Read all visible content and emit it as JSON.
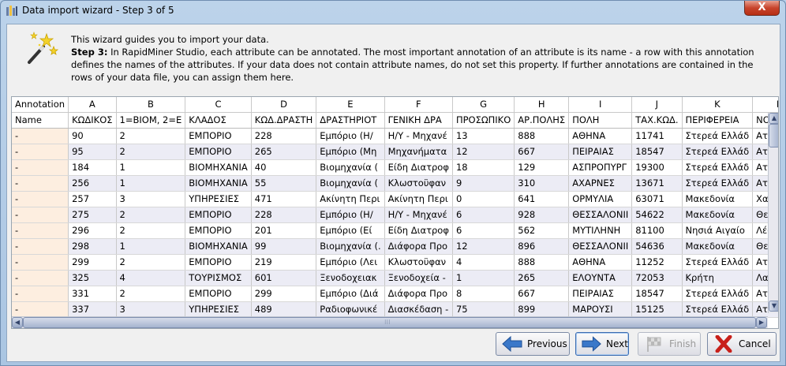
{
  "window": {
    "title": "Data import wizard - Step 3 of 5",
    "close_label": "X"
  },
  "intro": {
    "line1": "This wizard guides you to import your data.",
    "step_label": "Step 3:",
    "step_text": " In RapidMiner Studio, each attribute can be annotated. The most important annotation of an attribute is its name - a row with this annotation defines the names of the attributes. If your data does not contain attribute names, do not set this property. If further annotations are contained in the rows of your data file, you can assign them here."
  },
  "grid": {
    "annotation_header": "Annotation",
    "column_letters": [
      "A",
      "B",
      "C",
      "D",
      "E",
      "F",
      "G",
      "H",
      "I",
      "J",
      "K",
      "L"
    ],
    "header_row": {
      "annotation": "Name",
      "cells": [
        "ΚΩΔΙΚΟΣ",
        "1=ΒΙΟΜ, 2=Ε",
        "ΚΛΑΔΟΣ",
        "ΚΩΔ.ΔΡΑΣΤΗ",
        "ΔΡΑΣΤΗΡΙΟΤ",
        "ΓΕΝΙΚΗ ΔΡΑ",
        "ΠΡΟΣΩΠΙΚΟ",
        "ΑΡ.ΠΟΛΗΣ",
        "ΠΟΛΗ",
        "ΤΑΧ.ΚΩΔ.",
        "ΠΕΡΙΦΕΡΕΙΑ",
        "ΝΟΜΟΣ"
      ]
    },
    "rows": [
      {
        "annotation": "-",
        "cells": [
          "90",
          "2",
          "ΕΜΠΟΡΙΟ",
          "228",
          "Εμπόριο (Η/",
          "Η/Υ - Μηχανέ",
          "13",
          "888",
          "ΑΘΗΝΑ",
          "11741",
          "Στερεά Ελλάδ",
          "Αττική"
        ]
      },
      {
        "annotation": "-",
        "cells": [
          "95",
          "2",
          "ΕΜΠΟΡΙΟ",
          "265",
          "Εμπόριο (Μη",
          "Μηχανήματα",
          "12",
          "667",
          "ΠΕΙΡΑΙΑΣ",
          "18547",
          "Στερεά Ελλάδ",
          "Αττική"
        ]
      },
      {
        "annotation": "-",
        "cells": [
          "184",
          "1",
          "ΒΙΟΜΗΧΑΝΙΑ",
          "40",
          "Βιομηχανία (",
          "Είδη Διατροφ",
          "18",
          "129",
          "ΑΣΠΡΟΠΥΡΓ",
          "19300",
          "Στερεά Ελλάδ",
          "Αττική"
        ]
      },
      {
        "annotation": "-",
        "cells": [
          "256",
          "1",
          "ΒΙΟΜΗΧΑΝΙΑ",
          "55",
          "Βιομηχανία (",
          "Κλωστοϋφαν",
          "9",
          "310",
          "ΑΧΑΡΝΕΣ",
          "13671",
          "Στερεά Ελλάδ",
          "Αττική"
        ]
      },
      {
        "annotation": "-",
        "cells": [
          "257",
          "3",
          "ΥΠΗΡΕΣΙΕΣ",
          "471",
          "Ακίνητη Περι",
          "Ακίνητη Περι",
          "0",
          "641",
          "ΟΡΜΥΛΙΑ",
          "63071",
          "Μακεδονία",
          "Χαλκιδική"
        ]
      },
      {
        "annotation": "-",
        "cells": [
          "275",
          "2",
          "ΕΜΠΟΡΙΟ",
          "228",
          "Εμπόριο (Η/",
          "Η/Υ - Μηχανέ",
          "6",
          "928",
          "ΘΕΣΣΑΛΟΝΙΙ",
          "54622",
          "Μακεδονία",
          "Θεσσαλον"
        ]
      },
      {
        "annotation": "-",
        "cells": [
          "296",
          "2",
          "ΕΜΠΟΡΙΟ",
          "201",
          "Εμπόριο (Εί",
          "Είδη Διατροφ",
          "6",
          "562",
          "ΜΥΤΙΛΗΝΗ",
          "81100",
          "Νησιά Αιγαίο",
          "Λέσβος"
        ]
      },
      {
        "annotation": "-",
        "cells": [
          "298",
          "1",
          "ΒΙΟΜΗΧΑΝΙΑ",
          "99",
          "Βιομηχανία (.",
          "Διάφορα Προ",
          "12",
          "896",
          "ΘΕΣΣΑΛΟΝΙΙ",
          "54636",
          "Μακεδονία",
          "Θεσσαλον"
        ]
      },
      {
        "annotation": "-",
        "cells": [
          "299",
          "2",
          "ΕΜΠΟΡΙΟ",
          "219",
          "Εμπόριο (Λει",
          "Κλωστοϋφαν",
          "4",
          "888",
          "ΑΘΗΝΑ",
          "11252",
          "Στερεά Ελλάδ",
          "Αττική"
        ]
      },
      {
        "annotation": "-",
        "cells": [
          "325",
          "4",
          "ΤΟΥΡΙΣΜΟΣ",
          "601",
          "Ξενοδοχειακ",
          "Ξενοδοχεία -",
          "1",
          "265",
          "ΕΛΟΥΝΤΑ",
          "72053",
          "Κρήτη",
          "Λασίθι"
        ]
      },
      {
        "annotation": "-",
        "cells": [
          "331",
          "2",
          "ΕΜΠΟΡΙΟ",
          "299",
          "Εμπόριο (Διά",
          "Διάφορα Προ",
          "8",
          "667",
          "ΠΕΙΡΑΙΑΣ",
          "18547",
          "Στερεά Ελλάδ",
          "Αττική"
        ]
      },
      {
        "annotation": "-",
        "cells": [
          "337",
          "3",
          "ΥΠΗΡΕΣΙΕΣ",
          "489",
          "Ραδιοφωνικέ",
          "Διασκέδαση -",
          "75",
          "899",
          "ΜΑΡΟΥΣΙ",
          "15125",
          "Στερεά Ελλάδ",
          "Αττική"
        ]
      }
    ]
  },
  "buttons": {
    "previous": "Previous",
    "next": "Next",
    "finish": "Finish",
    "cancel": "Cancel"
  }
}
